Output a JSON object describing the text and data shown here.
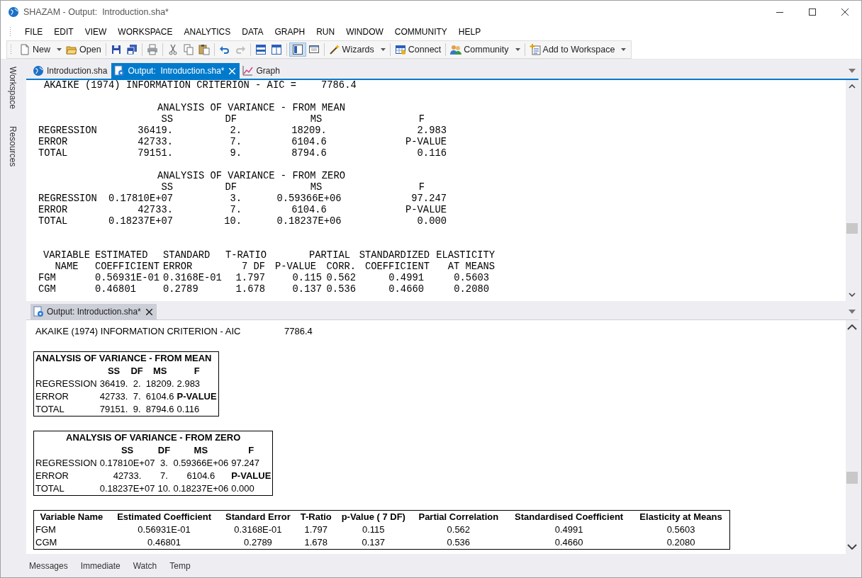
{
  "window": {
    "title": "SHAZAM - Output:  Introduction.sha*"
  },
  "menu": [
    "FILE",
    "EDIT",
    "VIEW",
    "WORKSPACE",
    "ANALYTICS",
    "DATA",
    "GRAPH",
    "RUN",
    "WINDOW",
    "COMMUNITY",
    "HELP"
  ],
  "toolbar": {
    "groups": [
      [
        {
          "label": "New",
          "dropdown": true
        },
        {
          "label": "Open",
          "dropdown": false
        }
      ],
      [
        {
          "dropdown": false
        },
        {
          "dropdown": false
        }
      ],
      [
        {
          "dropdown": false
        }
      ],
      [
        {
          "dropdown": false
        },
        {
          "dropdown": false
        },
        {
          "dropdown": false
        }
      ],
      [
        {
          "dropdown": false,
          "disabled": false
        },
        {
          "dropdown": false,
          "disabled": true
        }
      ],
      [
        {
          "dropdown": false
        },
        {
          "dropdown": false
        }
      ],
      [
        {
          "dropdown": false,
          "pressed": true
        },
        {
          "dropdown": false,
          "pressed": false
        }
      ],
      [
        {
          "label": "Wizards",
          "dropdown": true
        }
      ],
      [
        {
          "label": "Connect",
          "dropdown": false
        }
      ],
      [
        {
          "label": "Community",
          "dropdown": true
        }
      ],
      [
        {
          "label": "Add to Workspace",
          "dropdown": true
        }
      ]
    ]
  },
  "side_panel": {
    "tabs": [
      "Workspace",
      "Resources"
    ]
  },
  "top_pane": {
    "tabs": [
      {
        "label": "Introduction.sha",
        "kind": "script",
        "selected": false,
        "closable": false
      },
      {
        "label": "Output:  Introduction.sha*",
        "kind": "output",
        "selected": true,
        "closable": true
      },
      {
        "label": "Graph",
        "kind": "graph",
        "selected": false,
        "closable": false
      }
    ],
    "output": {
      "criterion": {
        "label": "AKAIKE (1974) INFORMATION CRITERION - AIC =",
        "value": "7786.4"
      },
      "anova": [
        {
          "title": "ANALYSIS OF VARIANCE - FROM MEAN",
          "columns": [
            "SS",
            "DF",
            "MS",
            "F"
          ],
          "rows": [
            {
              "label": "REGRESSION",
              "cells": [
                "36419.",
                "2.",
                "18209.",
                "2.983"
              ]
            },
            {
              "label": "ERROR",
              "cells": [
                "42733.",
                "7.",
                "6104.6"
              ],
              "p_value_label": "P-VALUE"
            },
            {
              "label": "TOTAL",
              "cells": [
                "79151.",
                "9.",
                "8794.6",
                "0.116"
              ]
            }
          ]
        },
        {
          "title": "ANALYSIS OF VARIANCE - FROM ZERO",
          "columns": [
            "SS",
            "DF",
            "MS",
            "F"
          ],
          "rows": [
            {
              "label": "REGRESSION",
              "cells": [
                "0.17810E+07",
                "3.",
                "0.59366E+06",
                "97.247"
              ]
            },
            {
              "label": "ERROR",
              "cells": [
                "42733.",
                "7.",
                "6104.6"
              ],
              "p_value_label": "P-VALUE"
            },
            {
              "label": "TOTAL",
              "cells": [
                "0.18237E+07",
                "10.",
                "0.18237E+06",
                "0.000"
              ]
            }
          ]
        }
      ],
      "coefficients": {
        "header_rows": [
          [
            {
              "text": "VARIABLE"
            },
            {
              "text": "ESTIMATED"
            },
            {
              "text": "STANDARD"
            },
            {
              "text": "T-RATIO"
            },
            {
              "text": "PARTIAL"
            },
            {
              "text": "STANDARDIZED"
            },
            {
              "text": "ELASTICITY"
            }
          ],
          [
            {
              "text": "NAME"
            },
            {
              "text": "COEFFICIENT"
            },
            {
              "text": "ERROR"
            },
            {
              "text": "7 DF"
            },
            {
              "text": "P-VALUE"
            },
            {
              "text": "CORR."
            },
            {
              "text": "COEFFICIENT"
            },
            {
              "text": "AT MEANS"
            }
          ]
        ],
        "rows": [
          {
            "name": "FGM",
            "values": [
              "0.56931E-01",
              "0.3168E-01",
              "1.797",
              "0.115",
              "0.562",
              "0.4991",
              "0.5603"
            ]
          },
          {
            "name": "CGM",
            "values": [
              "0.46801",
              "0.2789",
              "1.678",
              "0.137",
              "0.536",
              "0.4660",
              "0.2080"
            ]
          }
        ]
      }
    }
  },
  "bottom_pane": {
    "tabs": [
      {
        "label": "Output: Introduction.sha*",
        "kind": "output",
        "selected": true,
        "closable": true
      }
    ],
    "output": {
      "criterion": {
        "label": "AKAIKE (1974) INFORMATION CRITERION - AIC",
        "value": "7786.4"
      },
      "anova": [
        {
          "title": "ANALYSIS OF VARIANCE - FROM MEAN",
          "columns": [
            "SS",
            "DF",
            "MS",
            "F"
          ],
          "rows": [
            {
              "label": "REGRESSION",
              "cells": [
                "36419.",
                "2.",
                "18209.",
                "2.983"
              ]
            },
            {
              "label": "ERROR",
              "cells": [
                "42733.",
                "7.",
                "6104.6"
              ],
              "p_value_label": "P-VALUE"
            },
            {
              "label": "TOTAL",
              "cells": [
                "79151.",
                "9.",
                "8794.6",
                "0.116"
              ]
            }
          ]
        },
        {
          "title": "ANALYSIS OF VARIANCE - FROM ZERO",
          "columns": [
            "SS",
            "DF",
            "MS",
            "F"
          ],
          "rows": [
            {
              "label": "REGRESSION",
              "cells": [
                "0.17810E+07",
                "3.",
                "0.59366E+06",
                "97.247"
              ]
            },
            {
              "label": "ERROR",
              "cells": [
                "42733.",
                "7.",
                "6104.6"
              ],
              "p_value_label": "P-VALUE"
            },
            {
              "label": "TOTAL",
              "cells": [
                "0.18237E+07",
                "10.",
                "0.18237E+06",
                "0.000"
              ]
            }
          ]
        }
      ],
      "coefficients": {
        "columns": [
          "Variable Name",
          "Estimated Coefficient",
          "Standard Error",
          "T-Ratio",
          "p-Value ( 7 DF)",
          "Partial Correlation",
          "Standardised Coefficient",
          "Elasticity at Means"
        ],
        "rows": [
          {
            "name": "FGM",
            "values": [
              "0.56931E-01",
              "0.3168E-01",
              "1.797",
              "0.115",
              "0.562",
              "0.4991",
              "0.5603"
            ]
          },
          {
            "name": "CGM",
            "values": [
              "0.46801",
              "0.2789",
              "1.678",
              "0.137",
              "0.536",
              "0.4660",
              "0.2080"
            ]
          }
        ]
      }
    }
  },
  "bottom_tabs": [
    "Messages",
    "Immediate",
    "Watch",
    "Temp"
  ]
}
